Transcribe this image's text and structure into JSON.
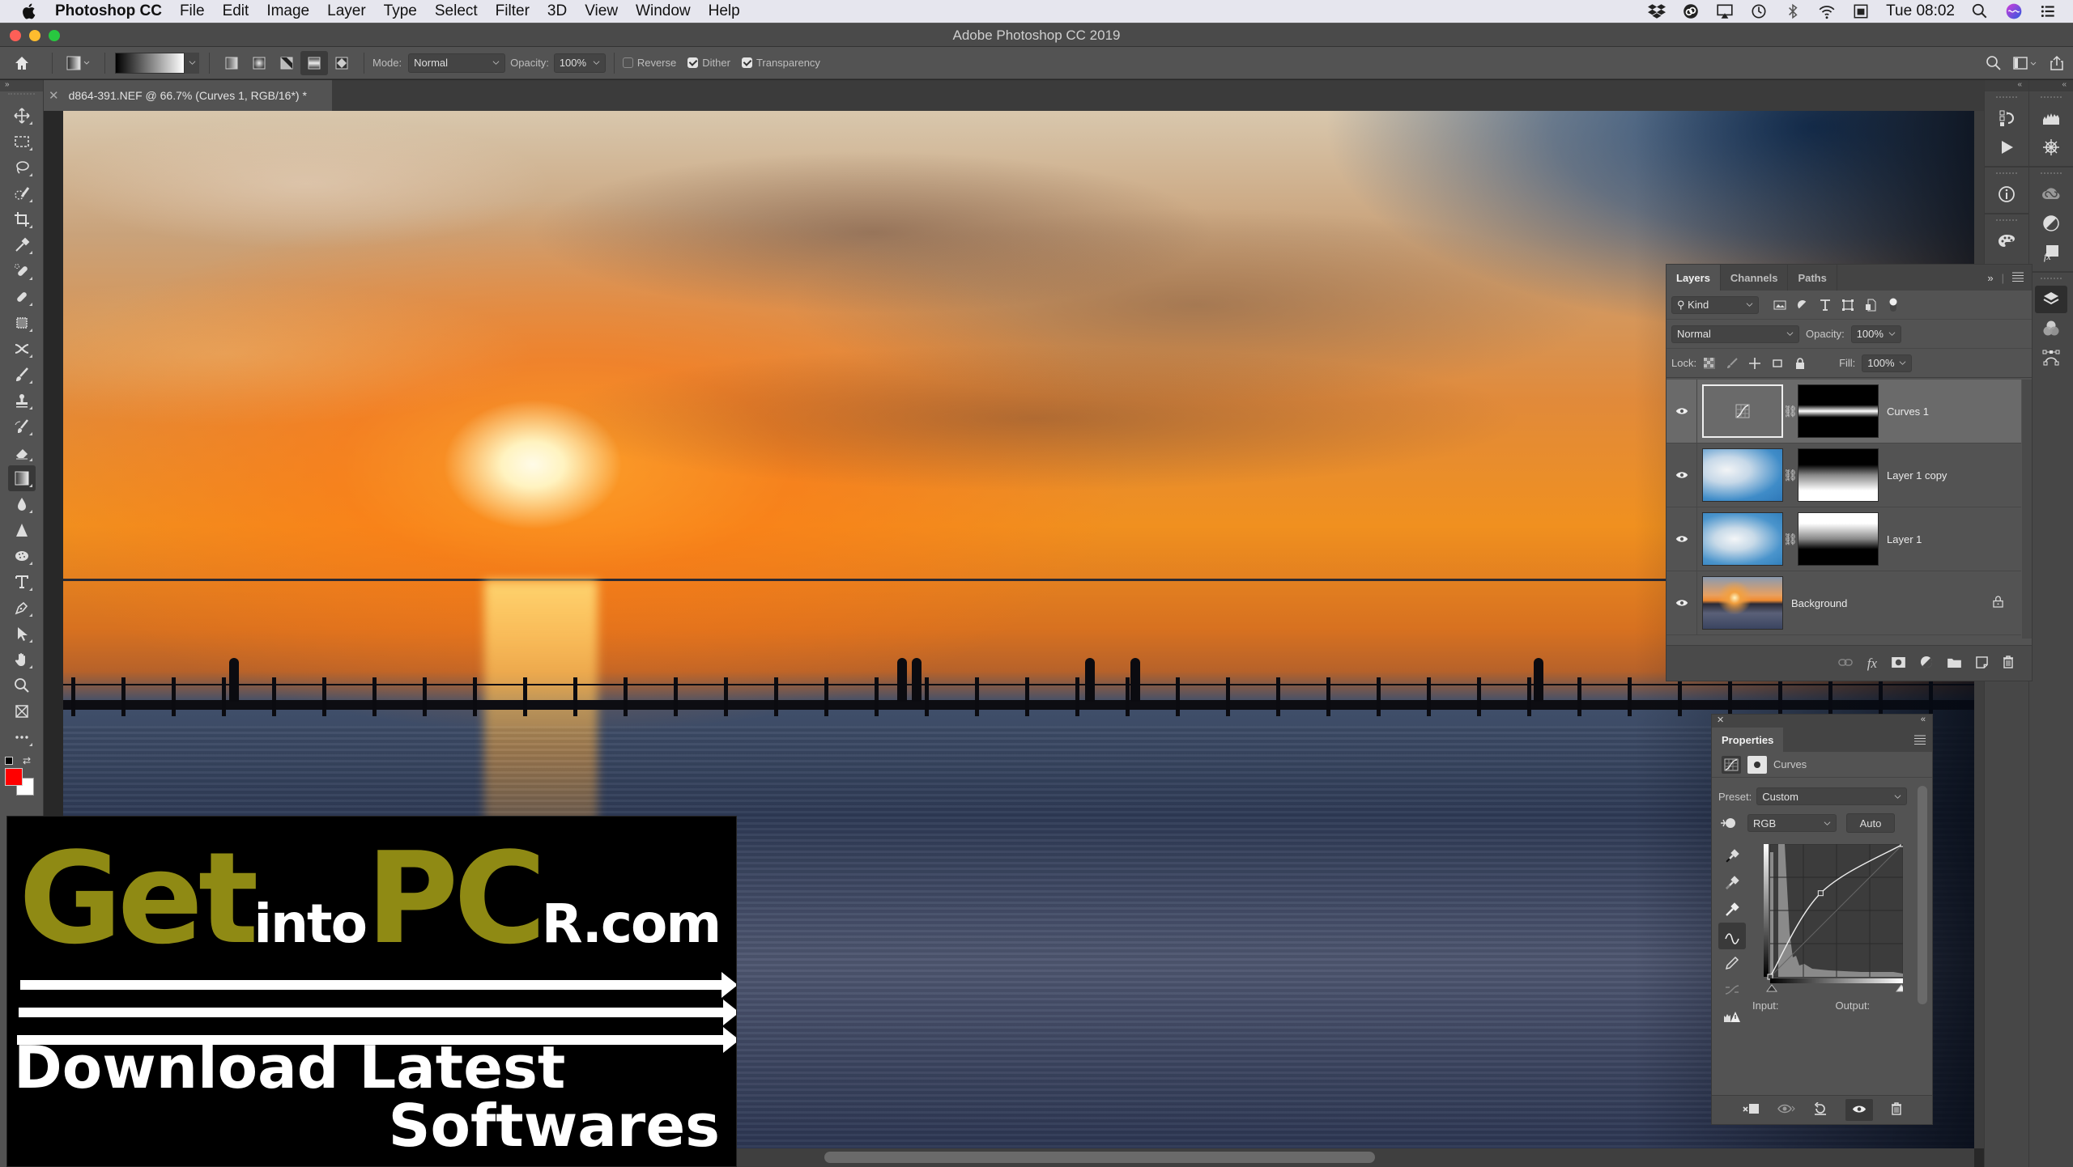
{
  "menubar": {
    "app_name": "Photoshop CC",
    "items": [
      "File",
      "Edit",
      "Image",
      "Layer",
      "Type",
      "Select",
      "Filter",
      "3D",
      "View",
      "Window",
      "Help"
    ],
    "clock": "Tue 08:02",
    "status_icons": [
      "dropbox-icon",
      "creative-cloud-icon",
      "airplay-icon",
      "time-machine-icon",
      "bluetooth-icon",
      "wifi-icon",
      "keyboard-viewer-icon",
      "spotlight-icon",
      "siri-icon",
      "notification-center-icon"
    ]
  },
  "window": {
    "title": "Adobe Photoshop CC 2019",
    "traffic_lights": {
      "close": "#fe5f57",
      "minimize": "#febc2e",
      "zoom": "#28c840"
    }
  },
  "options_bar": {
    "tool": "gradient",
    "gradient_styles": [
      "linear",
      "radial",
      "angle",
      "reflected",
      "diamond"
    ],
    "active_style_index": 3,
    "mode_label": "Mode:",
    "mode_value": "Normal",
    "opacity_label": "Opacity:",
    "opacity_value": "100%",
    "reverse_label": "Reverse",
    "reverse_checked": false,
    "dither_label": "Dither",
    "dither_checked": true,
    "transparency_label": "Transparency",
    "transparency_checked": true
  },
  "document": {
    "tab_title": "d864-391.NEF @ 66.7% (Curves 1, RGB/16*) *"
  },
  "toolbar": {
    "tools": [
      "move",
      "rectangular-marquee",
      "lasso",
      "quick-selection",
      "crop",
      "eyedropper",
      "spot-healing-brush",
      "healing-brush",
      "patch",
      "content-aware-move",
      "brush",
      "clone-stamp",
      "history-brush",
      "eraser",
      "gradient",
      "blur",
      "sharpen",
      "sponge",
      "type",
      "pen",
      "path-selection",
      "hand",
      "zoom",
      "frame",
      "edit-toolbar"
    ],
    "active_tool": "gradient",
    "foreground_color": "#ff0000",
    "background_color": "#ffffff"
  },
  "layers_panel": {
    "tabs": [
      "Layers",
      "Channels",
      "Paths"
    ],
    "active_tab": "Layers",
    "filter_kind": "Kind",
    "blend_mode": "Normal",
    "opacity_label": "Opacity:",
    "opacity_value": "100%",
    "lock_label": "Lock:",
    "fill_label": "Fill:",
    "fill_value": "100%",
    "layers": [
      {
        "name": "Curves 1",
        "type": "adjustment",
        "visible": true,
        "selected": true,
        "mask": "band"
      },
      {
        "name": "Layer 1 copy",
        "type": "image",
        "visible": true,
        "selected": false,
        "mask": "bottom-white"
      },
      {
        "name": "Layer 1",
        "type": "image",
        "visible": true,
        "selected": false,
        "mask": "top-white"
      },
      {
        "name": "Background",
        "type": "image",
        "visible": true,
        "selected": false,
        "locked": true
      }
    ]
  },
  "properties_panel": {
    "title": "Properties",
    "adjustment_name": "Curves",
    "preset_label": "Preset:",
    "preset_value": "Custom",
    "channel_value": "RGB",
    "auto_label": "Auto",
    "input_label": "Input:",
    "output_label": "Output:",
    "curve_points": [
      [
        0,
        0
      ],
      [
        0.38,
        0.63
      ],
      [
        1,
        1
      ]
    ]
  },
  "watermark": {
    "get": "Get",
    "into": "into",
    "pc": "PC",
    "rcom": "R.com",
    "line2": "Download Latest",
    "line3": "Softwares",
    "olive_color": "#8f8a14"
  }
}
